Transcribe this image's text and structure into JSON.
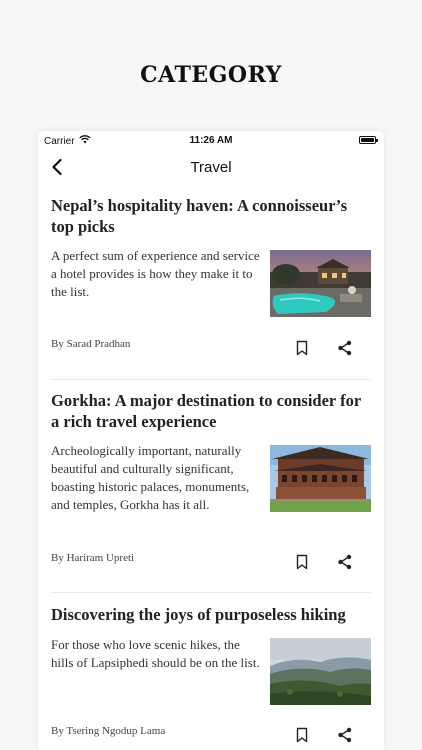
{
  "promo": {
    "title": "CATEGORY"
  },
  "status_bar": {
    "carrier": "Carrier",
    "time": "11:26 AM"
  },
  "nav": {
    "title": "Travel",
    "back_icon": "chevron-left-icon"
  },
  "articles": [
    {
      "title": "Nepal’s hospitality haven: A connoisseur’s top picks",
      "excerpt": "A perfect sum of experience and service a hotel provides is how they make it to the list.",
      "author": "By Sarad Pradhan",
      "thumbnail": "hotel-pool-photo"
    },
    {
      "title": "Gorkha: A major destination to consider for a rich travel experience",
      "excerpt": "Archeologically important, naturally beautiful and culturally significant, boasting historic palaces, monuments, and temples, Gorkha has it all.",
      "author": "By Hariram Upreti",
      "thumbnail": "gorkha-palace-photo"
    },
    {
      "title": "Discovering the joys of purposeless hiking",
      "excerpt": "For those who love scenic hikes, the hills of Lapsiphedi should be on the list.",
      "author": "By Tsering Ngodup Lama",
      "thumbnail": "hills-landscape-photo"
    }
  ],
  "icons": {
    "bookmark": "bookmark-icon",
    "share": "share-icon"
  }
}
